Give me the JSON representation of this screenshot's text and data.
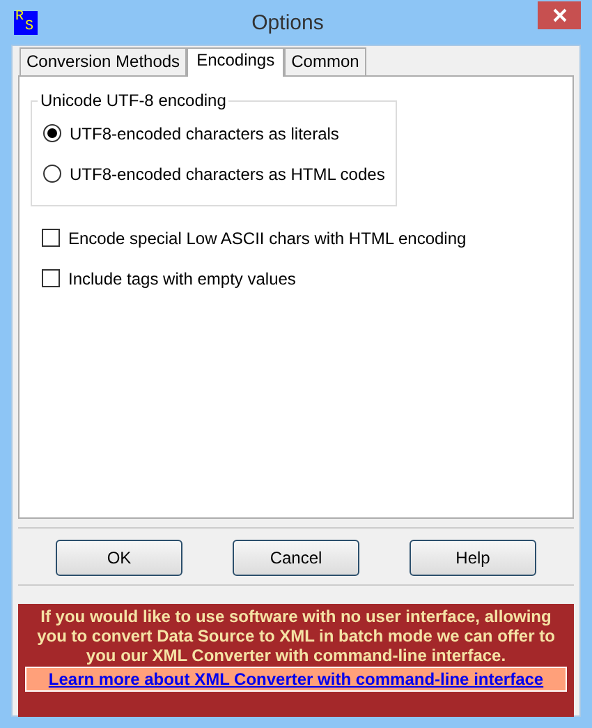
{
  "window": {
    "title": "Options",
    "app_icon": [
      "R",
      "S"
    ]
  },
  "tabs": [
    {
      "label": "Conversion Methods",
      "selected": false
    },
    {
      "label": "Encodings",
      "selected": true
    },
    {
      "label": "Common",
      "selected": false
    }
  ],
  "encoding_group": {
    "title": "Unicode UTF-8 encoding",
    "options": [
      {
        "label": "UTF8-encoded characters as literals",
        "selected": true
      },
      {
        "label": "UTF8-encoded characters as HTML codes",
        "selected": false
      }
    ]
  },
  "checkboxes": [
    {
      "label": "Encode special Low ASCII chars with HTML encoding",
      "checked": false
    },
    {
      "label": "Include tags with empty values",
      "checked": false
    }
  ],
  "buttons": [
    "OK",
    "Cancel",
    "Help"
  ],
  "banner": {
    "text": "If you would like to use software with no user interface, allowing you to convert Data Source to XML in batch mode we can offer to you our XML Converter with command-line interface.",
    "link": "Learn more about XML Converter with command-line interface"
  }
}
